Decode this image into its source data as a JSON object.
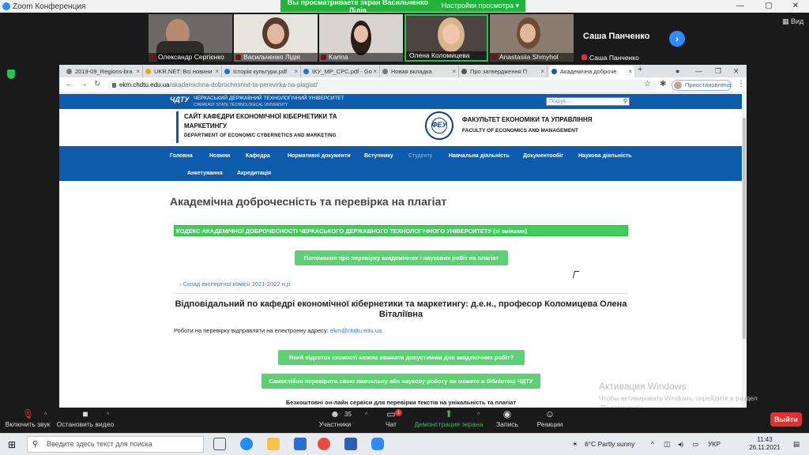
{
  "zoom": {
    "window_title": "Zoom Конференция",
    "share_banner": {
      "message": "Вы просматриваете экран Васильченко Лідія",
      "options": "Настройки просмотра ▾"
    },
    "participants": [
      "Олександр Сергієнко",
      "Васильченко Лідія",
      "Karina",
      "Олена Коломицева",
      "Anastasiia Shmyhol"
    ],
    "name_tile": {
      "big_name": "Саша Панченко",
      "label": "Саша Панченко"
    },
    "view_label": "▦ Вид",
    "toolbar": {
      "mute_label": "Включить звук",
      "video_label": "Остановить видео",
      "participants_label": "Участники",
      "participants_count": "35",
      "chat_label": "Чат",
      "chat_badge": "1",
      "share_label": "Демонстрация экрана",
      "record_label": "Запись",
      "reactions_label": "Реакции",
      "exit_label": "Выйти"
    },
    "colors": {
      "share_green": "#23c552",
      "exit_red": "#e03131",
      "accent_blue": "#2d8cff"
    }
  },
  "browser": {
    "tabs": [
      "2019-09_Regions-bra",
      "UKR.NET: Всі новини",
      "Історія культури.pdf",
      "ІКУ_МР_СРС.pdf - Go",
      "Новая вкладка",
      "Про затвердження П",
      "Академічна доброче"
    ],
    "url_domain": "ekm.chdtu.edu.ua",
    "url_path": "/akademichna-dobrochesnist-ta-perevirka-na-plagiat/",
    "profile_label": "Приостановлена"
  },
  "site": {
    "uni_name": "ЧЕРКАСЬКИЙ ДЕРЖАВНИЙ ТЕХНОЛОГІЧНИЙ УНІВЕРСИТЕТ",
    "uni_name_en": "CHERKASY STATE TECHNOLOGICAL UNIVERSITY",
    "search_placeholder": "Пошук ...",
    "dept_line1": "САЙТ КАФЕДРИ ЕКОНОМІЧНОЇ КІБЕРНЕТИКИ ТА",
    "dept_line2": "МАРКЕТИНГУ",
    "dept_en": "DEPARTMENT OF ECONOMIC CYBERNETICS AND MARKETING",
    "seal_text": "ФЕУ",
    "faculty": "ФАКУЛЬТЕТ ЕКОНОМІКИ ТА УПРАВЛІННЯ",
    "faculty_en": "FACULTY OF ECONOMICS AND MANAGEMENT",
    "menu": [
      "Головна",
      "Новини",
      "Кафедра",
      "Нормативні документи",
      "Вступнику",
      "Студенту",
      "Навчальна діяльність",
      "Документообіг",
      "Наукова діяльність",
      "Анкетування",
      "Акредитація"
    ],
    "page_title": "Академічна доброчесність та перевірка на плагіат",
    "code_bar": "КОДЕКС АКАДЕМІЧНОЇ ДОБРОЧЕСНОСТІ ЧЕРКАСЬКОГО ДЕРЖАВНОГО ТЕХНОЛОГІЧНОГО УНІВЕРСИТЕТУ (зі змінами)",
    "btn_regulation": "Положення про перевірку академічних і наукових робіт на плагіат",
    "expert_link": "› Склад експертної комісії 2021-2022 н.р.",
    "responsible": "Відповідальний по кафедрі економічної кібернетики та маркетингу: д.е.н., професор Коломицева Олена Віталіївна",
    "works_text": "Роботи на перевірку відправляти на електронну адресу: ",
    "works_email": "ekm@chdtu.edu.ua",
    "btn_percent": "Який відсоток схожості можна вважати допустимим для академічних робіт?",
    "btn_library": "Самостійно перевірити свою навчальну або наукову роботу ви можете в бібліотеці ЧДТУ",
    "free_services": "Безкоштовні он-лайн сервіси для перевірки текстів на унікальність та плагіат"
  },
  "windows": {
    "activation_title": "Активация Windows",
    "activation_text": "Чтобы активировать Windows, перейдите в раздел \"Параметры\".",
    "search_placeholder": "Введите здесь текст для поиска",
    "weather": "6°C  Partly sunny",
    "lang": "УКР",
    "time": "11:43",
    "date": "26.11.2021"
  }
}
